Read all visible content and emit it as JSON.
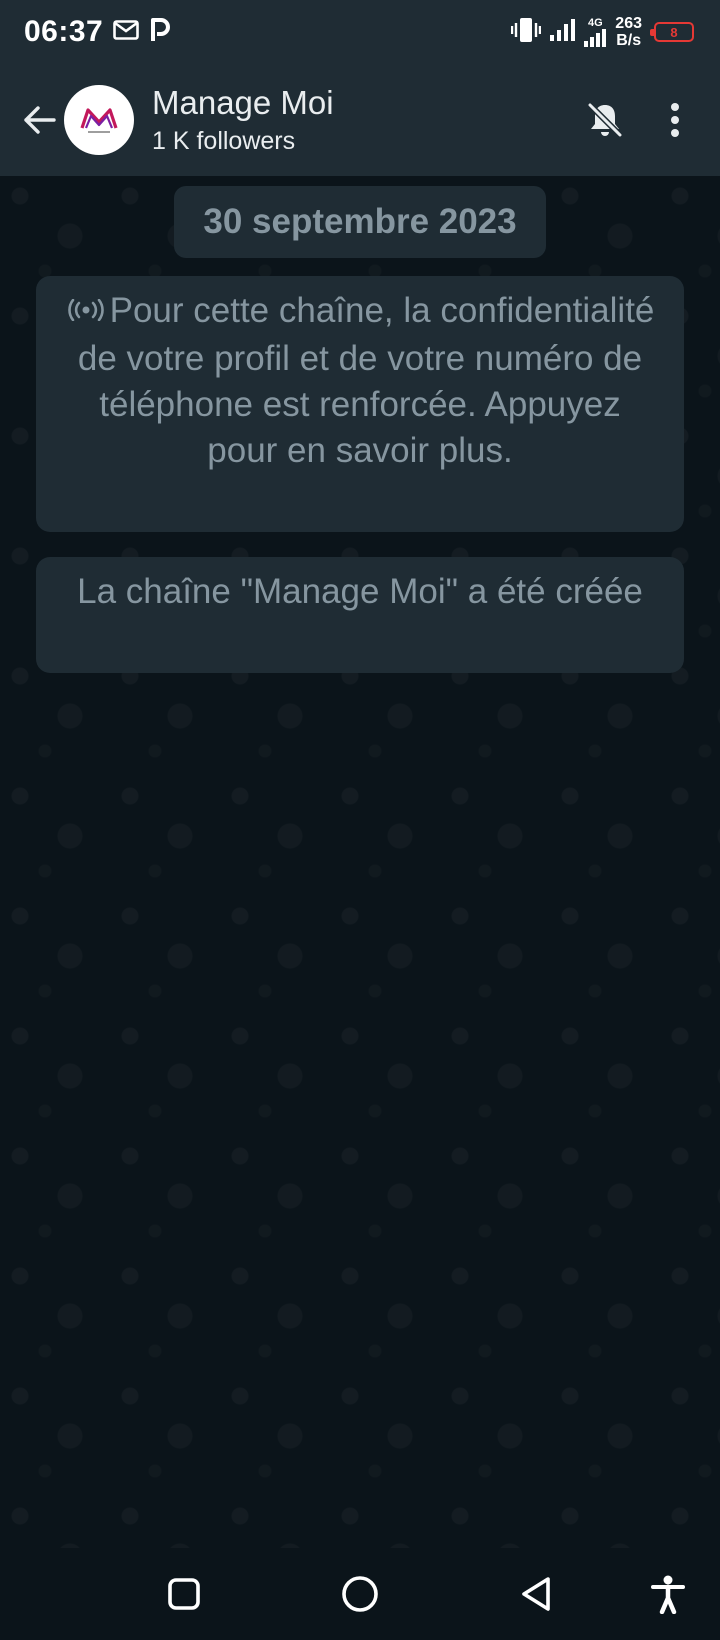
{
  "status_bar": {
    "time": "06:37",
    "network": "4G",
    "speed_value": "263",
    "speed_unit": "B/s",
    "battery_level": "8",
    "icons": [
      "mail-icon",
      "parking-app-icon",
      "vibrate-icon",
      "signal-icon",
      "signal-4g-icon",
      "battery-icon"
    ]
  },
  "header": {
    "channel_name": "Manage Moi",
    "followers": "1 K followers",
    "avatar": "manage-moi-logo",
    "actions": [
      "mute-bell-icon",
      "more-options-icon"
    ]
  },
  "chat": {
    "date_chip": "30 septembre 2023",
    "privacy_notice": "Pour cette chaîne, la confidentialité de votre profil et de votre numéro de téléphone est renforcée. Appuyez pour en savoir plus.",
    "created_notice": "La chaîne \"Manage Moi\" a été créée"
  },
  "nav_bar": {
    "buttons": [
      "recents-button",
      "home-button",
      "back-button",
      "accessibility-button"
    ]
  },
  "colors": {
    "header_bg": "#1f2c34",
    "chat_bg": "#0b141a",
    "bubble_bg": "#1f2c34",
    "system_text": "#8696a0",
    "battery_low": "#e53935"
  }
}
